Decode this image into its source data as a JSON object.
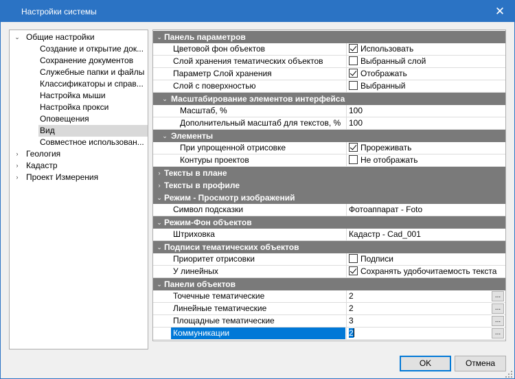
{
  "window": {
    "title": "Настройки системы"
  },
  "tree": {
    "items": [
      {
        "label": "Общие настройки",
        "caret": "expanded"
      },
      {
        "label": "Создание и открытие док..."
      },
      {
        "label": "Сохранение документов"
      },
      {
        "label": "Служебные папки и файлы"
      },
      {
        "label": "Классификаторы и справ..."
      },
      {
        "label": "Настройка мыши"
      },
      {
        "label": "Настройка прокси"
      },
      {
        "label": "Оповещения"
      },
      {
        "label": "Вид",
        "selected": true
      },
      {
        "label": "Совместное использован..."
      },
      {
        "label": "Геология",
        "caret": "collapsed"
      },
      {
        "label": "Кадастр",
        "caret": "collapsed"
      },
      {
        "label": "Проект Измерения",
        "caret": "collapsed"
      }
    ]
  },
  "grid": {
    "sections": {
      "s1": "Панель параметров",
      "s1a": "Масштабирование элементов интерфейса",
      "s1b": "Элементы",
      "s2": "Тексты в плане",
      "s3": "Тексты в профиле",
      "s4": "Режим - Просмотр изображений",
      "s5": "Режим-Фон объектов",
      "s6": "Подписи тематических объектов",
      "s7": "Панели объектов"
    },
    "props": {
      "p1": {
        "name": "Цветовой фон объектов",
        "value": "Использовать",
        "checked": true
      },
      "p2": {
        "name": "Слой хранения тематических объектов",
        "value": "Выбранный слой",
        "checked": false
      },
      "p3": {
        "name": "Параметр Слой хранения",
        "value": "Отображать",
        "checked": true
      },
      "p4": {
        "name": "Слой с поверхностью",
        "value": "Выбранный",
        "checked": false
      },
      "p5": {
        "name": "Масштаб, %",
        "value": "100"
      },
      "p6": {
        "name": "Дополнительный масштаб для текстов, %",
        "value": "100"
      },
      "p7": {
        "name": "При упрощенной отрисовке",
        "value": "Прореживать",
        "checked": true
      },
      "p8": {
        "name": "Контуры проектов",
        "value": "Не отображать",
        "checked": false
      },
      "p9": {
        "name": "Символ подсказки",
        "value": "Фотоаппарат - Foto"
      },
      "p10": {
        "name": "Штриховка",
        "value": "Кадастр - Cad_001"
      },
      "p11": {
        "name": "Приоритет отрисовки",
        "value": "Подписи",
        "checked": false
      },
      "p12": {
        "name": "У линейных",
        "value": "Сохранять удобочитаемость текста",
        "checked": true
      },
      "p13": {
        "name": "Точечные тематические",
        "value": "2",
        "button": "..."
      },
      "p14": {
        "name": "Линейные тематические",
        "value": "2",
        "button": "..."
      },
      "p15": {
        "name": "Площадные тематические",
        "value": "3",
        "button": "..."
      },
      "p16": {
        "name": "Коммуникации",
        "value": "2",
        "button": "..."
      }
    }
  },
  "buttons": {
    "ok": "OK",
    "cancel": "Отмена"
  },
  "colors": {
    "titlebar": "#2b73c4",
    "section": "#7a7a7a",
    "selection": "#0078d7"
  },
  "icons": {
    "close": "close-icon",
    "expanded": "caret-down-icon",
    "collapsed": "caret-right-icon",
    "check": "checkmark-icon"
  }
}
